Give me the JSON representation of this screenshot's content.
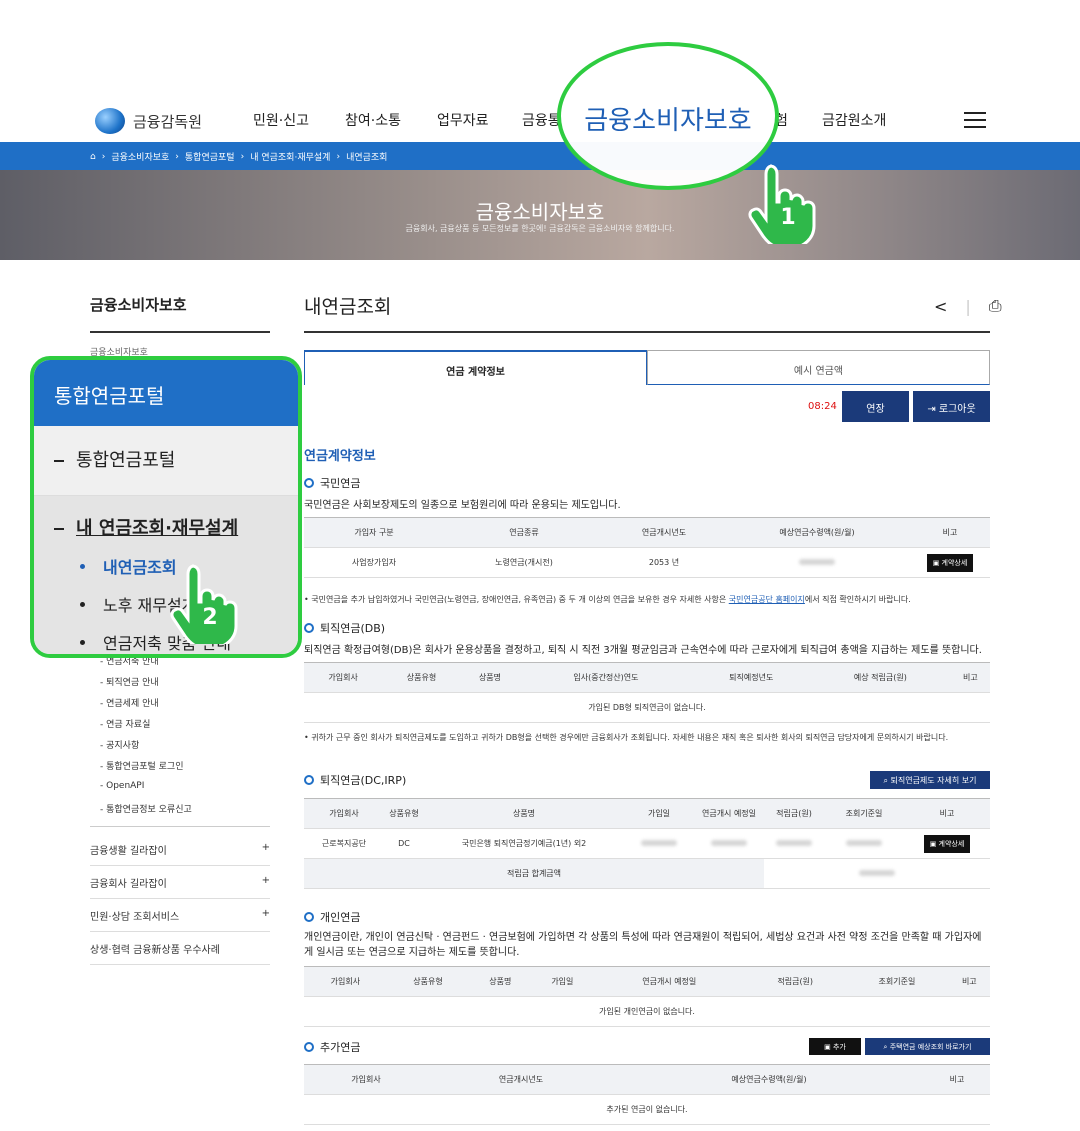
{
  "header": {
    "logo_text": "금융감독원",
    "nav": [
      "민원·신고",
      "참여·소통",
      "업무자료",
      "금융통",
      "금융소비자보호",
      "금감원소개"
    ],
    "nav_partial_right": "험"
  },
  "breadcrumb": [
    "금융소비자보호",
    "통합연금포털",
    "내 연금조회·재무설계",
    "내연금조회"
  ],
  "hero": {
    "title": "금융소비자보호",
    "subtitle": "금융회사, 금융상품 등 모든정보를 한곳에! 금융감독은 금융소비자와 함께합니다."
  },
  "annotations": {
    "step1": "1",
    "step2": "2"
  },
  "sidebar": {
    "title": "금융소비자보호",
    "first_item": "금융소비자보호",
    "sub_items": [
      "연금저축 안내",
      "퇴직연금 안내",
      "연금세제 안내",
      "연금 자료실",
      "공지사항",
      "통합연금포털 로그인",
      "OpenAPI",
      "통합연금정보 오류신고"
    ],
    "accordions": [
      "금융생활 길라잡이",
      "금융회사 길라잡이",
      "민원·상담 조회서비스",
      "상생·협력 금융新상품 우수사례"
    ],
    "plus": "+"
  },
  "callout": {
    "header": "통합연금포털",
    "row1": "통합연금포털",
    "row2": "내 연금조회·재무설계",
    "items": [
      "내연금조회",
      "노후 재무설계",
      "연금저축 맞춤 안내"
    ]
  },
  "main": {
    "title": "내연금조회",
    "tabs": [
      "연금 계약정보",
      "예시 연금액"
    ],
    "timer": "08:24",
    "extend_btn": "연장",
    "logout_btn": "로그아웃",
    "section_title": "연금계약정보",
    "national": {
      "heading": "국민연금",
      "desc": "국민연금은 사회보장제도의 일종으로 보험원리에 따라 운용되는 제도입니다.",
      "headers": [
        "가입자 구분",
        "연금종류",
        "연금개시년도",
        "예상연금수령액(원/월)",
        "비고"
      ],
      "row": [
        "사업장가입자",
        "노령연금(개시전)",
        "2053 년"
      ],
      "detail_btn": "계약상세",
      "note": "국민연금을 추가 납입하였거나 국민연금(노령연금, 장애인연금, 유족연금) 중 두 개 이상의 연금을 보유한 경우 자세한 사항은",
      "note_link": "국민연금공단 홈페이지",
      "note_end": "에서 직접 확인하시기 바랍니다."
    },
    "db": {
      "heading": "퇴직연금(DB)",
      "desc": "퇴직연금 확정급여형(DB)은 회사가 운용상품을 결정하고, 퇴직 시 직전 3개월 평균임금과 근속연수에 따라 근로자에게 퇴직급여 총액을 지급하는 제도를 뜻합니다.",
      "headers": [
        "가입회사",
        "상품유형",
        "상품명",
        "입사(중간정산)연도",
        "퇴직예정년도",
        "예상 적립금(원)",
        "비고"
      ],
      "empty": "가입된 DB형 퇴직연금이 없습니다.",
      "note": "귀하가 근무 중인 회사가 퇴직연금제도를 도입하고 귀하가 DB형을 선택한 경우에만 금융회사가 조회됩니다. 자세한 내용은 재직 혹은 퇴사한 회사의 퇴직연금 담당자에게 문의하시기 바랍니다."
    },
    "dc": {
      "heading": "퇴직연금(DC,IRP)",
      "btn": "퇴직연금제도 자세히 보기",
      "headers": [
        "가입회사",
        "상품유형",
        "상품명",
        "가입일",
        "연금개시 예정일",
        "적립금(원)",
        "조회기준일",
        "비고"
      ],
      "row": [
        "근로복지공단",
        "DC",
        "국민은행 퇴직연금정기예금(1년) 외2"
      ],
      "detail_btn": "계약상세",
      "sum_label": "적립금 합계금액"
    },
    "personal": {
      "heading": "개인연금",
      "desc": "개인연금이란, 개인이 연금신탁 · 연금펀드 · 연금보험에 가입하면 각 상품의 특성에 따라 연금재원이 적립되어, 세법상 요건과 사전 약정 조건을 만족할 때 가입자에게 일시금 또는 연금으로 지급하는 제도를 뜻합니다.",
      "headers": [
        "가입회사",
        "상품유형",
        "상품명",
        "가입일",
        "연금개시 예정일",
        "적립금(원)",
        "조회기준일",
        "비고"
      ],
      "empty": "가입된 개인연금이 없습니다."
    },
    "additional": {
      "heading": "추가연금",
      "add_btn": "추가",
      "housing_btn": "주택연금 예상조회 바로가기",
      "headers": [
        "가입회사",
        "연금개시년도",
        "예상연금수령액(원/월)",
        "비고"
      ],
      "empty": "추가된 연금이 없습니다."
    }
  },
  "colors": {
    "accent_blue": "#1f6fc6",
    "highlight_green": "#2ecc40",
    "navy_button": "#1b3a7a"
  }
}
